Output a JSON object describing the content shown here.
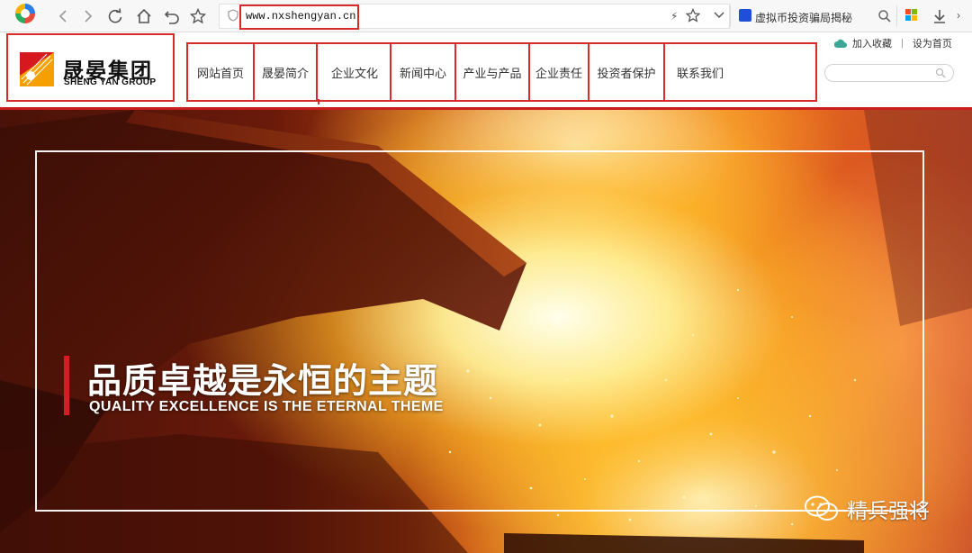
{
  "browser": {
    "url": "www.nxshengyan.cn",
    "bookmark_text": "虚拟币投资骗局揭秘",
    "icons": [
      "back-icon",
      "forward-icon",
      "reload-icon",
      "home-icon",
      "undo-icon",
      "star-icon",
      "shield-icon",
      "bolt-icon",
      "dropdown-icon",
      "search-icon",
      "windows-icon",
      "download-icon"
    ]
  },
  "site": {
    "logo": {
      "cn": "晟晏集团",
      "en": "SHENG YAN GROUP"
    },
    "nav": [
      "网站首页",
      "晟晏简介",
      "企业文化",
      "新闻中心",
      "产业与产品",
      "企业责任",
      "投资者保护",
      "联系我们"
    ],
    "top_links": {
      "favorite": "加入收藏",
      "separator": "|",
      "homepage": "设为首页"
    },
    "search": {
      "placeholder": ""
    }
  },
  "hero": {
    "slogan_cn": "品质卓越是永恒的主题",
    "slogan_en": "QUALITY EXCELLENCE IS THE ETERNAL THEME"
  },
  "watermark": {
    "text": "精兵强将"
  },
  "colors": {
    "highlight": "#d92a2a",
    "brand_red": "#c81e1e",
    "logo_orange": "#f5a000"
  }
}
